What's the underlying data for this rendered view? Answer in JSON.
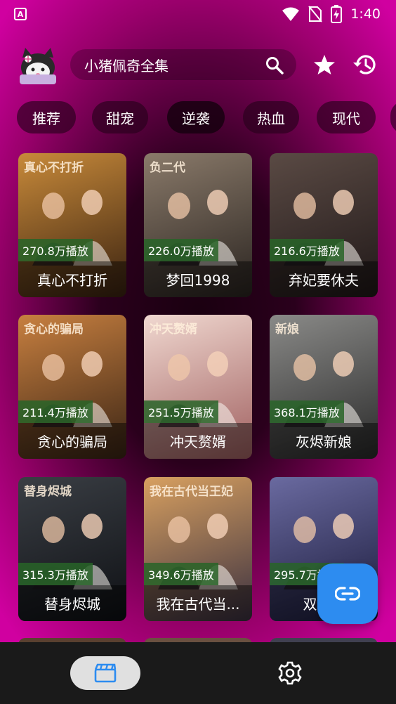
{
  "status": {
    "time": "1:40"
  },
  "search": {
    "query": "小猪佩奇全集"
  },
  "tabs": [
    {
      "label": "推荐"
    },
    {
      "label": "甜宠"
    },
    {
      "label": "逆袭"
    },
    {
      "label": "热血"
    },
    {
      "label": "现代"
    }
  ],
  "cards": [
    {
      "title": "真心不打折",
      "plays": "270.8万播放",
      "poster_text": "真心不打折",
      "color_a": "#c88a3a",
      "color_b": "#3a2210"
    },
    {
      "title": "梦回1998",
      "plays": "226.0万播放",
      "poster_text": "负二代",
      "color_a": "#8a7a6a",
      "color_b": "#2a2420"
    },
    {
      "title": "弃妃要休夫",
      "plays": "216.6万播放",
      "poster_text": "",
      "color_a": "#5a4a44",
      "color_b": "#201818"
    },
    {
      "title": "贪心的骗局",
      "plays": "211.4万播放",
      "poster_text": "贪心的骗局",
      "color_a": "#c88040",
      "color_b": "#3a2414"
    },
    {
      "title": "冲天赘婿",
      "plays": "251.5万播放",
      "poster_text": "冲天赘婿",
      "color_a": "#f0d8d0",
      "color_b": "#a06060"
    },
    {
      "title": "灰烬新娘",
      "plays": "368.1万播放",
      "poster_text": "新娘",
      "color_a": "#8a8a88",
      "color_b": "#2a2a2a"
    },
    {
      "title": "替身烬城",
      "plays": "315.3万播放",
      "poster_text": "替身烬城",
      "color_a": "#3a3e44",
      "color_b": "#0e1014"
    },
    {
      "title": "我在古代当...",
      "plays": "349.6万播放",
      "poster_text": "我在古代当王妃",
      "color_a": "#d8a060",
      "color_b": "#3a3040"
    },
    {
      "title": "双世...",
      "plays": "295.7万播放",
      "poster_text": "",
      "color_a": "#6a6aa0",
      "color_b": "#1a1a3a"
    }
  ]
}
